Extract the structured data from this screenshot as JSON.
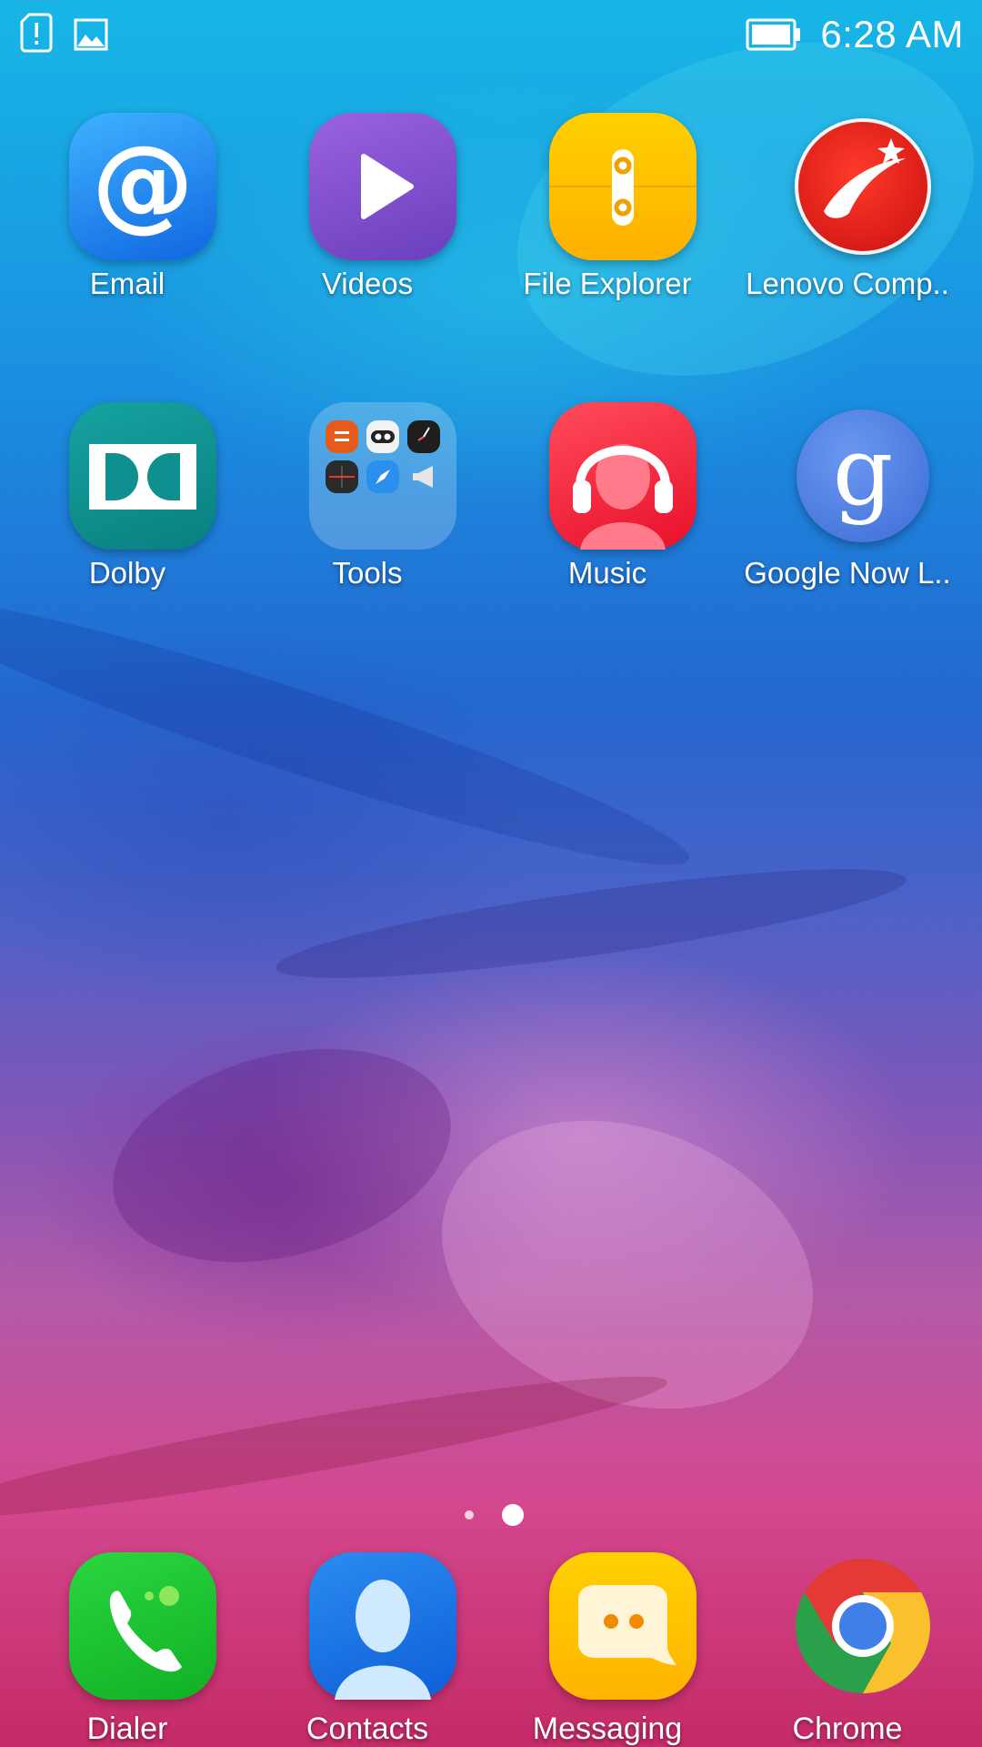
{
  "status_bar": {
    "time": "6:28 AM",
    "left_icons": [
      "sim-alert-icon",
      "image-icon"
    ],
    "right_icons": [
      "battery-icon"
    ]
  },
  "apps": [
    {
      "name": "email",
      "label": "Email",
      "icon": "email-at-icon"
    },
    {
      "name": "videos",
      "label": "Videos",
      "icon": "play-icon"
    },
    {
      "name": "file-explorer",
      "label": "File Explorer",
      "icon": "file-explorer-icon"
    },
    {
      "name": "lenovo-companion",
      "label": "Lenovo Comp..",
      "icon": "lenovo-companion-icon"
    },
    {
      "name": "dolby",
      "label": "Dolby",
      "icon": "dolby-icon"
    },
    {
      "name": "tools",
      "label": "Tools",
      "icon": "folder-icon"
    },
    {
      "name": "music",
      "label": "Music",
      "icon": "headphones-icon"
    },
    {
      "name": "google-now-launcher",
      "label": "Google Now L..",
      "icon": "google-icon"
    }
  ],
  "dock": [
    {
      "name": "dialer",
      "label": "Dialer",
      "icon": "phone-icon"
    },
    {
      "name": "contacts",
      "label": "Contacts",
      "icon": "contact-icon"
    },
    {
      "name": "messaging",
      "label": "Messaging",
      "icon": "chat-icon"
    },
    {
      "name": "chrome",
      "label": "Chrome",
      "icon": "chrome-icon"
    }
  ],
  "page_indicator": {
    "pages": 2,
    "current": 2
  },
  "colors": {
    "email": "#1e8ff0",
    "videos": "#7a4fc9",
    "file_explorer": "#ffc400",
    "lenovo": "#e02020",
    "dolby": "#0f8f8f",
    "music": "#ff2a3a",
    "google": "#4a7ee0",
    "dialer": "#1cc231",
    "contacts": "#1673e6",
    "messaging": "#ffc300"
  }
}
